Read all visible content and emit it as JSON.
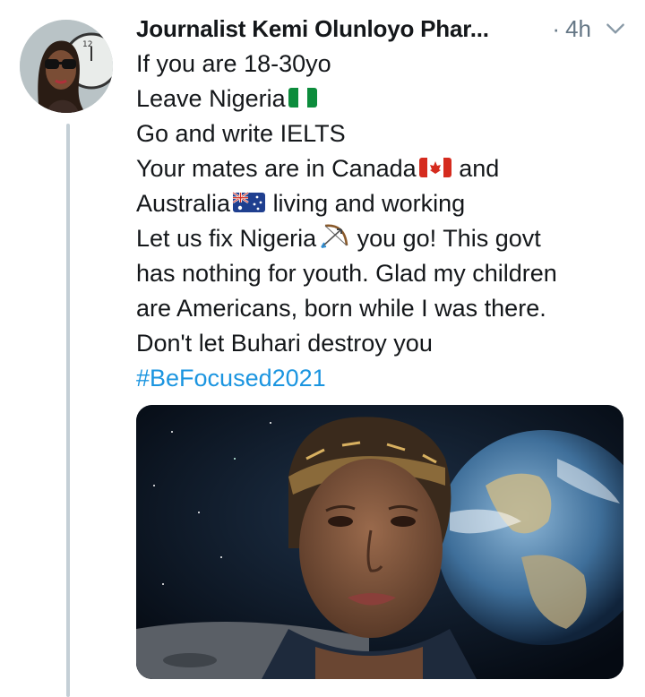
{
  "tweet": {
    "author_name": "Journalist Kemi Olunloyo Phar...",
    "timestamp": "4h",
    "separator": "·",
    "lines": [
      "If you are 18-30yo",
      "Leave Nigeria",
      "Go and write IELTS",
      "Your mates are in Canada",
      "and",
      "Australia",
      "living and working",
      "Let us fix Nigeria",
      "you go! This govt",
      "has nothing for youth. Glad my children",
      "are Americans, born while I was there.",
      "Don't let Buhari destroy you"
    ],
    "hashtag": "#BeFocused2021",
    "emoji_icons": [
      "nigeria-flag-icon",
      "canada-flag-icon",
      "australia-flag-icon",
      "bow-and-arrow-icon"
    ]
  },
  "colors": {
    "text": "#14171a",
    "meta": "#657786",
    "hashtag": "#1b95e0",
    "thread_line": "#c4cfd6"
  }
}
